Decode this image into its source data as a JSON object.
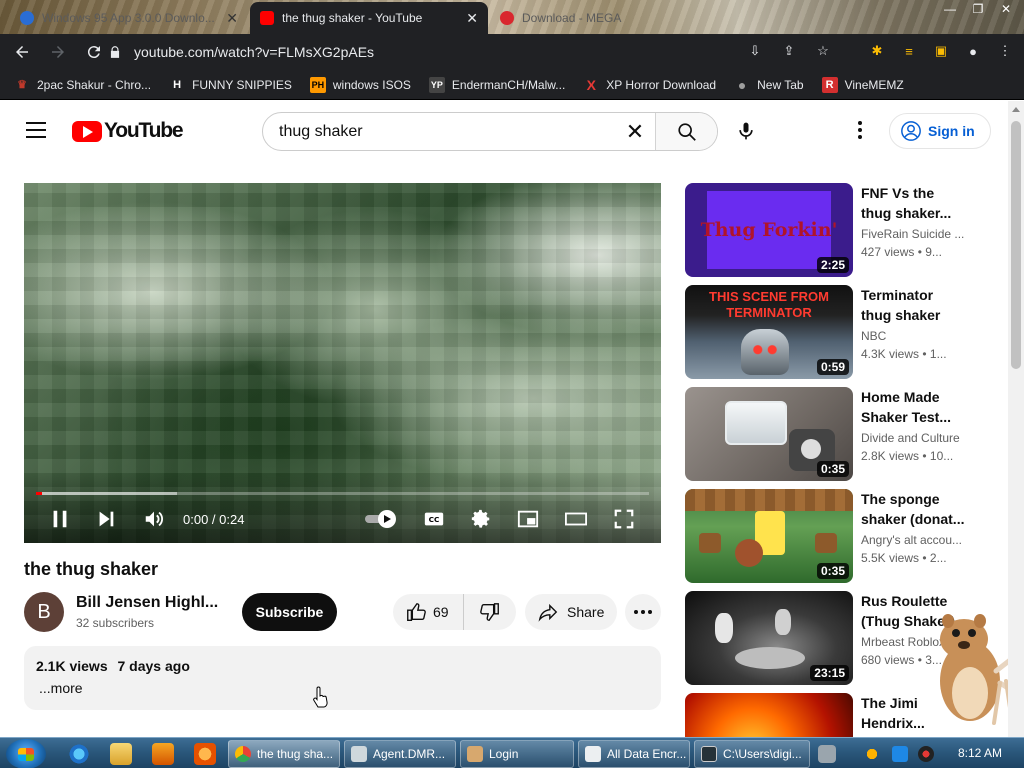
{
  "browser": {
    "tabs": [
      {
        "label": "Windows 95 App 3.0.0 Downlo...",
        "active": false,
        "icon": "app-tab-icon",
        "color": "#2a6dd3"
      },
      {
        "label": "the thug shaker - YouTube",
        "active": true,
        "icon": "youtube-favicon",
        "color": "#ff0000"
      },
      {
        "label": "Download - MEGA",
        "active": false,
        "icon": "mega-favicon",
        "color": "#d9272e"
      }
    ],
    "url": "youtube.com/watch?v=FLMsXG2pAEs",
    "bookmarks": [
      {
        "label": "2pac Shakur - Chro...",
        "icon": "2pac-bookmark-icon",
        "color": "#c0392b",
        "glyph": "♛"
      },
      {
        "label": "FUNNY SNIPPIES",
        "icon": "funny-bookmark-icon",
        "color": "#ffffff",
        "glyph": "H"
      },
      {
        "label": "windows ISOS",
        "icon": "ph-bookmark-icon",
        "color": "#ff9900",
        "glyph": "PH"
      },
      {
        "label": "EndermanCH/Malw...",
        "icon": "yp-bookmark-icon",
        "color": "#444444",
        "glyph": "YP"
      },
      {
        "label": "XP Horror Download",
        "icon": "x-bookmark-icon",
        "color": "#e53935",
        "glyph": "X"
      },
      {
        "label": "New Tab",
        "icon": "new-tab-bookmark-icon",
        "color": "#9e9e9e",
        "glyph": "●"
      },
      {
        "label": "VineMEMZ",
        "icon": "vine-bookmark-icon",
        "color": "#d32f2f",
        "glyph": "R"
      }
    ]
  },
  "youtube": {
    "logo_text": "YouTube",
    "search_value": "thug shaker",
    "sign_in": "Sign in",
    "video": {
      "time": "0:00 / 0:24",
      "progress_played": 0.01,
      "progress_loaded": 0.23,
      "title": "the thug shaker",
      "channel_initial": "B",
      "channel": "Bill Jensen Highl...",
      "subscribers": "32 subscribers",
      "subscribe": "Subscribe",
      "likes": "69",
      "share": "Share",
      "views": "2.1K views",
      "date": "7 days ago",
      "more": "...more"
    },
    "recommendations": [
      {
        "title": "FNF Vs the\nthug shaker...",
        "channel": "FiveRain Suicide ...",
        "views": "427 views  •  9...",
        "duration": "2:25",
        "thumb_text": "Thug Forkin'"
      },
      {
        "title": "Terminator\nthug shaker",
        "channel": "NBC",
        "views": "4.3K views  •  1...",
        "duration": "0:59",
        "thumb_text": "THIS SCENE FROM TERMINATOR"
      },
      {
        "title": "Home Made\nShaker Test...",
        "channel": "Divide and Culture",
        "views": "2.8K views  •  10...",
        "duration": "0:35",
        "thumb_text": ""
      },
      {
        "title": "The sponge\nshaker (donat...",
        "channel": "Angry's alt accou...",
        "views": "5.5K views  •  2...",
        "duration": "0:35",
        "thumb_text": ""
      },
      {
        "title": "Rus Roulette\n(Thug Shaker)",
        "channel": "Mrbeast Roblox",
        "views": "680 views  •  3...",
        "duration": "23:15",
        "thumb_text": ""
      },
      {
        "title": "The Jimi\nHendrix...",
        "channel": "",
        "views": "",
        "duration": "",
        "thumb_text": ""
      }
    ]
  },
  "taskbar": {
    "items": [
      {
        "label": "the thug sha...",
        "active": true,
        "color": "#4285f4"
      },
      {
        "label": "Agent.DMR...",
        "active": false,
        "color": "#cfd8dc"
      },
      {
        "label": "Login",
        "active": false,
        "color": "#d7a86e"
      },
      {
        "label": "All Data Encr...",
        "active": false,
        "color": "#eceff1"
      },
      {
        "label": "C:\\Users\\digi...",
        "active": false,
        "color": "#263238"
      }
    ],
    "clock": "8:12 AM"
  }
}
